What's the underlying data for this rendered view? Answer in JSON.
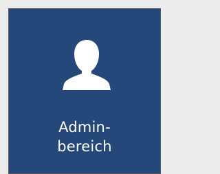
{
  "tile": {
    "label_lines": [
      "Admin-",
      "bereich"
    ],
    "icon": "user-silhouette-icon"
  },
  "colors": {
    "tile_background": "#25487a",
    "icon_and_text": "#ffffff",
    "page_background": "#ececec"
  }
}
